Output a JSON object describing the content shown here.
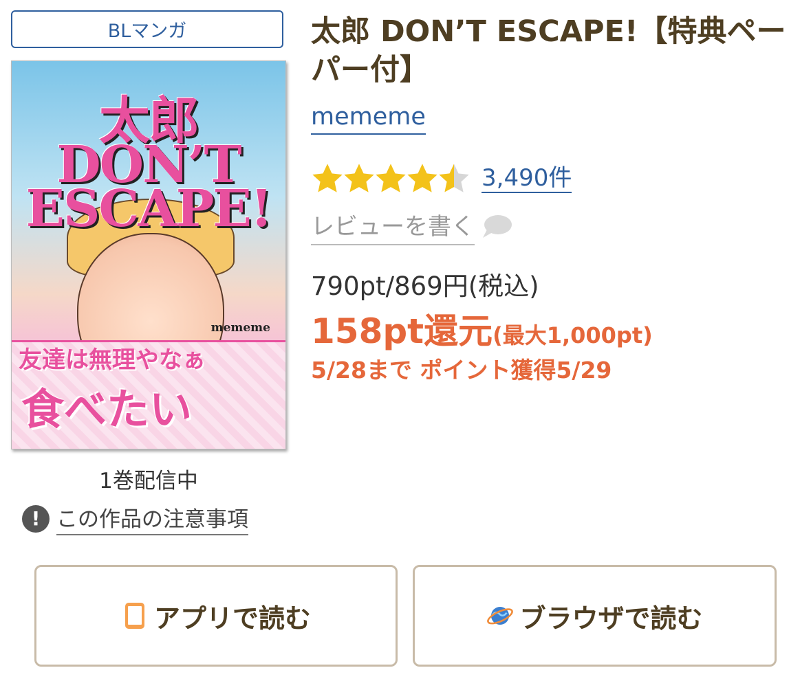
{
  "genre_tag": "BLマンガ",
  "book": {
    "title": "太郎 DON’T ESCAPE!【特典ペーパー付】",
    "author": "mememe",
    "rating_stars": 4.5,
    "review_count": "3,490件",
    "write_review": "レビューを書く",
    "price": "790pt/869円(税込)",
    "points_main": "158pt還元",
    "points_max": "(最大1,000pt)",
    "deadline": "5/28まで  ポイント獲得5/29",
    "volume_status": "1巻配信中",
    "notice_link": "この作品の注意事項"
  },
  "cover": {
    "title_line1": "太郎",
    "title_line2": "DON’T",
    "title_line3": "ESCAPE!",
    "author_credit": "mememe",
    "tagline1": "友達は無理やなぁ",
    "tagline2": "食べたい"
  },
  "buttons": {
    "app": "アプリで読む",
    "browser": "ブラウザで読む"
  },
  "colors": {
    "link_blue": "#2f5f9e",
    "title_brown": "#4e3e22",
    "point_orange": "#e5673a",
    "star_gold": "#f3c21a"
  }
}
